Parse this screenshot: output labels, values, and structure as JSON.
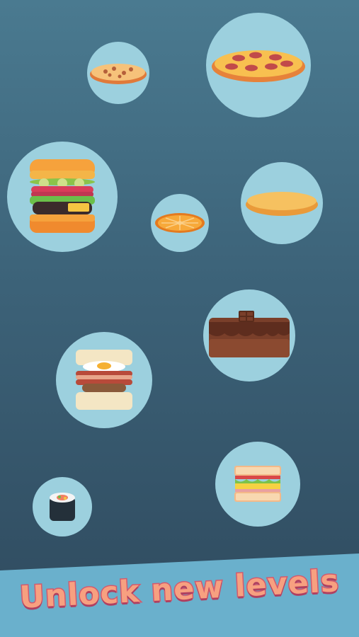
{
  "banner": {
    "title": "Unlock new levels"
  },
  "levels": [
    {
      "name": "cookie-pizza"
    },
    {
      "name": "pepperoni-pizza"
    },
    {
      "name": "burger"
    },
    {
      "name": "orange-slice"
    },
    {
      "name": "pancake"
    },
    {
      "name": "chocolate-cake"
    },
    {
      "name": "bacon-egg-sandwich"
    },
    {
      "name": "sushi-roll"
    },
    {
      "name": "club-sandwich"
    }
  ],
  "colors": {
    "background_top": "#4a7a90",
    "background_bottom": "#2f4a5e",
    "bubble": "#9cd0de",
    "banner": "#6ab0cc",
    "title_fill": "#f7a080",
    "title_stroke": "#d35a6e"
  }
}
